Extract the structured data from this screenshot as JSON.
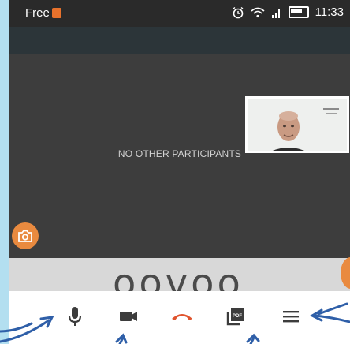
{
  "status_bar": {
    "carrier": "Free",
    "time": "11:33",
    "icons": [
      "sim-icon",
      "alarm-icon",
      "wifi-icon",
      "signal-icon",
      "battery-icon"
    ]
  },
  "call": {
    "empty_message": "NO OTHER PARTICIPANTS",
    "self_view": "self-video-preview",
    "logo_text": "oovoo"
  },
  "controls": [
    {
      "name": "microphone-icon"
    },
    {
      "name": "video-camera-icon"
    },
    {
      "name": "hang-up-icon",
      "color": "#e0542e"
    },
    {
      "name": "pdf-icon"
    },
    {
      "name": "menu-icon"
    }
  ],
  "colors": {
    "accent": "#e98a3f",
    "arrow": "#2f5fa8",
    "hangup": "#e0542e"
  }
}
